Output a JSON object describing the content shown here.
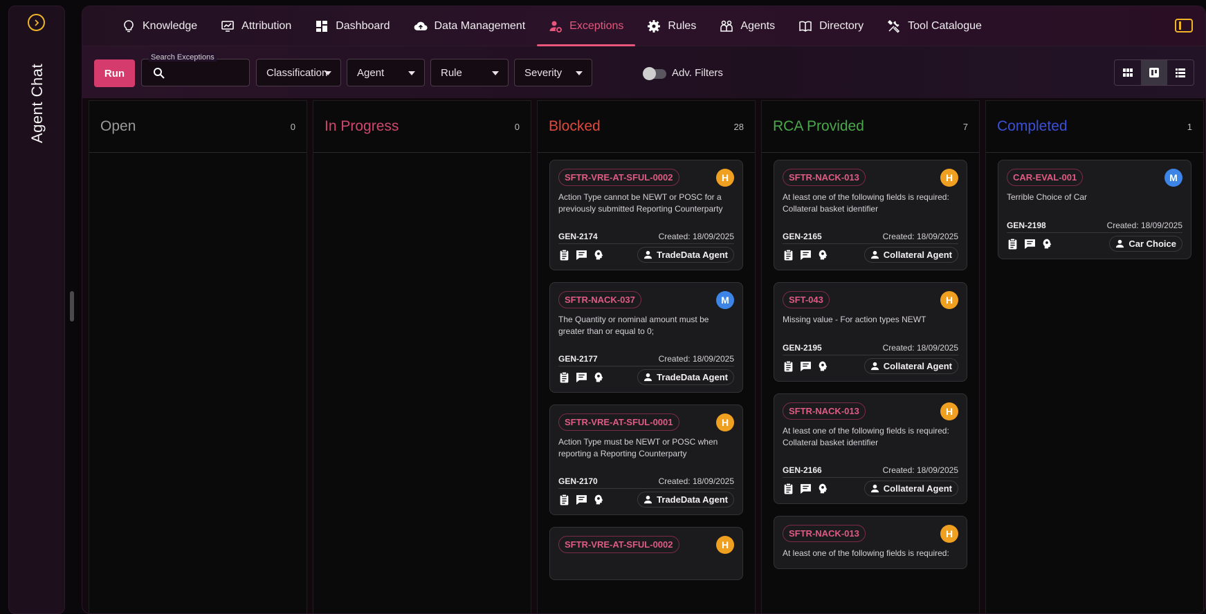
{
  "chat": {
    "label": "Agent Chat"
  },
  "nav": {
    "items": [
      {
        "label": "Knowledge",
        "icon": "lightbulb-icon"
      },
      {
        "label": "Attribution",
        "icon": "chart-monitor-icon"
      },
      {
        "label": "Dashboard",
        "icon": "dashboard-icon"
      },
      {
        "label": "Data Management",
        "icon": "cloud-upload-icon"
      },
      {
        "label": "Exceptions",
        "icon": "user-gear-icon",
        "active": true
      },
      {
        "label": "Rules",
        "icon": "gear-icon"
      },
      {
        "label": "Agents",
        "icon": "agents-icon"
      },
      {
        "label": "Directory",
        "icon": "book-icon"
      },
      {
        "label": "Tool Catalogue",
        "icon": "tools-icon"
      }
    ]
  },
  "filters": {
    "run_label": "Run",
    "search_legend": "Search Exceptions",
    "search_value": "",
    "classification": "Classification",
    "agent": "Agent",
    "rule": "Rule",
    "severity": "Severity",
    "adv_filters": "Adv. Filters"
  },
  "columns": [
    {
      "title": "Open",
      "count": "0",
      "color": "#9a9a9a",
      "cards": []
    },
    {
      "title": "In Progress",
      "count": "0",
      "color": "#d0476d",
      "cards": []
    },
    {
      "title": "Blocked",
      "count": "28",
      "color": "#e0483d",
      "cards": [
        {
          "tag": "SFTR-VRE-AT-SFUL-0002",
          "severity": "H",
          "desc": "Action Type cannot be NEWT or POSC for a previously submitted Reporting Counterparty",
          "gen": "GEN-2174",
          "created": "Created: 18/09/2025",
          "agent": "TradeData Agent"
        },
        {
          "tag": "SFTR-NACK-037",
          "severity": "M",
          "desc": "The Quantity or nominal amount must be greater than or equal to 0;",
          "gen": "GEN-2177",
          "created": "Created: 18/09/2025",
          "agent": "TradeData Agent"
        },
        {
          "tag": "SFTR-VRE-AT-SFUL-0001",
          "severity": "H",
          "desc": "Action Type must be NEWT or POSC when reporting a Reporting Counterparty",
          "gen": "GEN-2170",
          "created": "Created: 18/09/2025",
          "agent": "TradeData Agent"
        },
        {
          "tag": "SFTR-VRE-AT-SFUL-0002",
          "severity": "H",
          "desc": "",
          "gen": "",
          "created": "",
          "agent": ""
        }
      ]
    },
    {
      "title": "RCA Provided",
      "count": "7",
      "color": "#4aa84a",
      "cards": [
        {
          "tag": "SFTR-NACK-013",
          "severity": "H",
          "desc": "At least one of the following fields is required: Collateral basket identifier",
          "gen": "GEN-2165",
          "created": "Created: 18/09/2025",
          "agent": "Collateral Agent"
        },
        {
          "tag": "SFT-043",
          "severity": "H",
          "desc": "Missing value - For action types NEWT",
          "gen": "GEN-2195",
          "created": "Created: 18/09/2025",
          "agent": "Collateral Agent"
        },
        {
          "tag": "SFTR-NACK-013",
          "severity": "H",
          "desc": "At least one of the following fields is required: Collateral basket identifier",
          "gen": "GEN-2166",
          "created": "Created: 18/09/2025",
          "agent": "Collateral Agent"
        },
        {
          "tag": "SFTR-NACK-013",
          "severity": "H",
          "desc": "At least one of the following fields is required:",
          "gen": "",
          "created": "",
          "agent": ""
        }
      ]
    },
    {
      "title": "Completed",
      "count": "1",
      "color": "#3b4fd8",
      "cards": [
        {
          "tag": "CAR-EVAL-001",
          "severity": "M",
          "desc": "Terrible Choice of Car",
          "gen": "GEN-2198",
          "created": "Created: 18/09/2025",
          "agent": "Car Choice"
        }
      ]
    }
  ]
}
